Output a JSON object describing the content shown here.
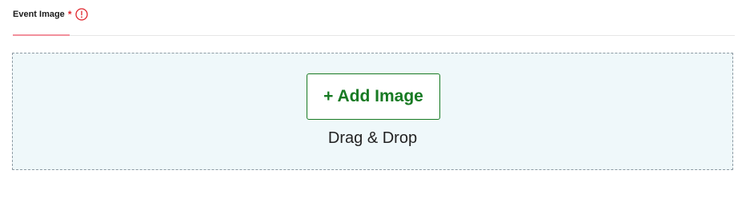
{
  "field": {
    "label": "Event Image",
    "required_marker": "*",
    "info_icon": "info-circle-icon"
  },
  "dropzone": {
    "button_label": "+ Add Image",
    "hint": "Drag & Drop"
  },
  "colors": {
    "required": "#e0242b",
    "accent_underline": "#f2909c",
    "button_green": "#177a23",
    "dropzone_bg": "#eff8fa",
    "dropzone_border": "#8c9aa3"
  }
}
